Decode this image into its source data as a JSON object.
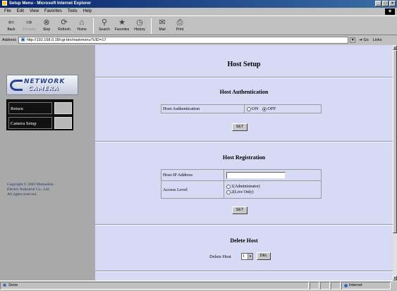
{
  "window": {
    "title": "Setup Menu - Microsoft Internet Explorer",
    "min_label": "_",
    "max_label": "□",
    "close_label": "×"
  },
  "menubar": {
    "items": [
      "File",
      "Edit",
      "View",
      "Favorites",
      "Tools",
      "Help"
    ]
  },
  "toolbar": {
    "buttons": [
      {
        "label": "Back",
        "icon": "back-arrow-icon",
        "glyph": "⇐"
      },
      {
        "label": "Forward",
        "icon": "forward-arrow-icon",
        "glyph": "⇒"
      },
      {
        "label": "Stop",
        "icon": "stop-icon",
        "glyph": "⊗"
      },
      {
        "label": "Refresh",
        "icon": "refresh-icon",
        "glyph": "⟳"
      },
      {
        "label": "Home",
        "icon": "home-icon",
        "glyph": "⌂"
      },
      {
        "label": "Search",
        "icon": "search-icon",
        "glyph": "⚲"
      },
      {
        "label": "Favorites",
        "icon": "favorites-icon",
        "glyph": "★"
      },
      {
        "label": "History",
        "icon": "history-icon",
        "glyph": "◷"
      },
      {
        "label": "Mail",
        "icon": "mail-icon",
        "glyph": "✉"
      },
      {
        "label": "Print",
        "icon": "print-icon",
        "glyph": "⎙"
      }
    ]
  },
  "addressbar": {
    "label": "Address",
    "url": "http://192.168.0.18/cgi-bin/mainmenu?UID=17",
    "go_label": "Go",
    "links_label": "Links"
  },
  "sidebar": {
    "logo_line1": "NETWORK",
    "logo_line2": "CAMERA",
    "nav": [
      {
        "label": "Return"
      },
      {
        "label": "Camera Setup"
      }
    ],
    "copyright_line1": "Copyright © 2003 Matsushita",
    "copyright_line2": "Electric Industrial Co., Ltd.",
    "copyright_line3": "All rights reserved."
  },
  "main": {
    "title": "Host Setup",
    "auth": {
      "heading": "Host Authentication",
      "field_label": "Host Authentication",
      "on_label": "ON",
      "off_label": "OFF",
      "selected": "OFF",
      "set_label": "SET"
    },
    "registration": {
      "heading": "Host Registration",
      "ip_label": "Host IP Address",
      "ip_value": "",
      "access_label": "Access Level",
      "access_options": [
        "1(Administrator)",
        "2(Live Only)"
      ],
      "set_label": "SET"
    },
    "delete": {
      "heading": "Delete Host",
      "field_label": "Delete Host",
      "selected_value": "1",
      "del_label": "DEL"
    }
  },
  "statusbar": {
    "status": "Done",
    "zone": "Internet"
  },
  "colors": {
    "main_bg": "#d6daf5",
    "sidebar_bg": "#a9a9a9",
    "nav_bg": "#111111",
    "title_bar": "#08246b"
  }
}
